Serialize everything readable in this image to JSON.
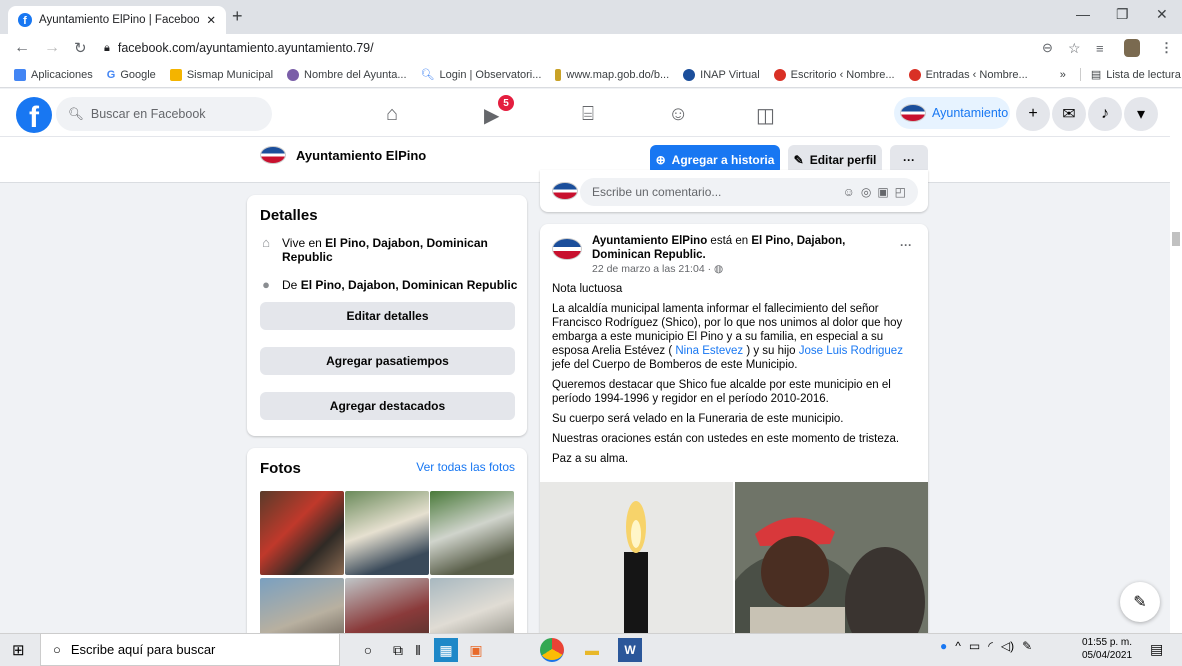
{
  "browser": {
    "tab_title": "Ayuntamiento ElPino | Facebook",
    "url": "facebook.com/ayuntamiento.ayuntamiento.79/"
  },
  "bookmarks": [
    {
      "label": "Aplicaciones",
      "color": "#e8453c"
    },
    {
      "label": "Google",
      "color": "#4285f4"
    },
    {
      "label": "Sismap Municipal",
      "color": "#f4b400"
    },
    {
      "label": "Nombre del Ayunta...",
      "color": "#7a5ea8"
    },
    {
      "label": "Login | Observatori...",
      "color": "#4285f4"
    },
    {
      "label": "www.map.gob.do/b...",
      "color": "#c9a227"
    },
    {
      "label": "INAP Virtual",
      "color": "#1b4e9b"
    },
    {
      "label": "Escritorio ‹ Nombre...",
      "color": "#d93025"
    },
    {
      "label": "Entradas ‹ Nombre...",
      "color": "#d93025"
    }
  ],
  "bookmarks_more": "»",
  "reading_list": "Lista de lectura",
  "fb": {
    "search_placeholder": "Buscar en Facebook",
    "notif_count": "5",
    "profile_name": "Ayuntamiento"
  },
  "page": {
    "name": "Ayuntamiento ElPino",
    "add_story": "Agregar a historia",
    "edit_profile": "Editar perfil",
    "more": "···"
  },
  "details": {
    "title": "Detalles",
    "lives_in_prefix": "Vive en ",
    "lives_in": "El Pino, Dajabon, Dominican Republic",
    "from_prefix": "De ",
    "from": "El Pino, Dajabon, Dominican Republic",
    "btn_edit": "Editar detalles",
    "btn_hobbies": "Agregar pasatiempos",
    "btn_featured": "Agregar destacados"
  },
  "photos": {
    "title": "Fotos",
    "see_all": "Ver todas las fotos"
  },
  "comment": {
    "placeholder": "Escribe un comentario..."
  },
  "post": {
    "author": "Ayuntamiento ElPino",
    "is_in": " está en ",
    "location": "El Pino, Dajabon, Dominican Republic.",
    "date": "22 de marzo a las 21:04 · ",
    "p1": "Nota luctuosa",
    "p2a": "La alcaldía municipal lamenta informar el fallecimiento del señor Francisco Rodríguez  (Shico), por lo que nos unimos al dolor que hoy embarga a este municipio El Pino y a su familia, en especial a su esposa Arelia Estévez  ( ",
    "link1": "Nina Estevez",
    "p2b": " ) y su hijo ",
    "link2": "Jose Luis Rodriguez",
    "p2c": " jefe del Cuerpo de Bomberos de este Municipio.",
    "p3": "Queremos destacar que Shico fue alcalde por este municipio en el período 1994-1996 y regidor en el período 2010-2016.",
    "p4": "Su cuerpo será velado en la Funeraria de este municipio.",
    "p5": "Nuestras oraciones están con ustedes en este momento de tristeza.",
    "p6": "Paz a su alma."
  },
  "taskbar": {
    "search_placeholder": "Escribe aquí para buscar",
    "time": "01:55 p. m.",
    "date": "05/04/2021"
  }
}
